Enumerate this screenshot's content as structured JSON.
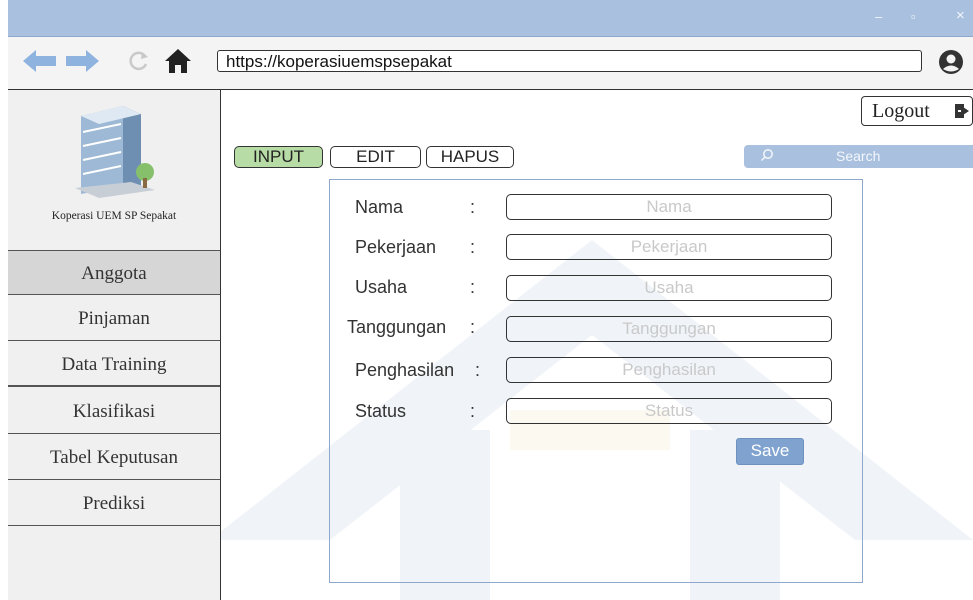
{
  "window": {
    "controls": {
      "minimize": "–",
      "maximize": "▫",
      "close": "×"
    }
  },
  "browser": {
    "url": "https://koperasiuemspsepakat",
    "icons": [
      "arrow-left-icon",
      "arrow-right-icon",
      "reload-icon",
      "home-icon",
      "user-account-icon"
    ]
  },
  "sidebar": {
    "logo_caption": "Koperasi UEM SP Sepakat",
    "items": [
      {
        "label": "Anggota",
        "active": true
      },
      {
        "label": "Pinjaman",
        "active": false
      },
      {
        "label": "Data Training",
        "active": false
      },
      {
        "label": "Klasifikasi",
        "active": false
      },
      {
        "label": "Tabel Keputusan",
        "active": false
      },
      {
        "label": "Prediksi",
        "active": false
      }
    ]
  },
  "header": {
    "logout_label": "Logout",
    "search_placeholder": "Search"
  },
  "tabs": {
    "input": "INPUT",
    "edit": "EDIT",
    "hapus": "HAPUS",
    "active": "INPUT"
  },
  "form": {
    "fields": [
      {
        "label": "Nama",
        "colon": ":",
        "placeholder": "Nama",
        "value": ""
      },
      {
        "label": "Pekerjaan",
        "colon": ":",
        "placeholder": "Pekerjaan",
        "value": ""
      },
      {
        "label": "Usaha",
        "colon": ":",
        "placeholder": "Usaha",
        "value": ""
      },
      {
        "label": "Tanggungan",
        "colon": ":",
        "placeholder": "Tanggungan",
        "value": ""
      },
      {
        "label": "Penghasilan",
        "colon": ":",
        "placeholder": "Penghasilan",
        "value": ""
      },
      {
        "label": "Status",
        "colon": ":",
        "placeholder": "Status",
        "value": ""
      }
    ],
    "save_label": "Save"
  },
  "colors": {
    "titlebar": "#a9c0df",
    "active_tab": "#b7dca5",
    "save_button": "#7fa2cf",
    "active_menu": "#d6d6d6"
  }
}
